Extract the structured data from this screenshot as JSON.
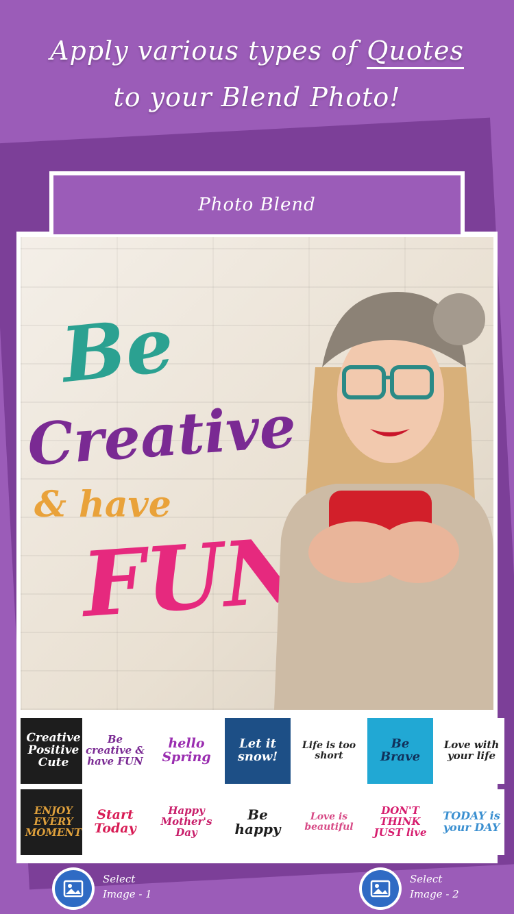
{
  "headline": {
    "line1_prefix": "Apply various types of ",
    "line1_highlight": "Quotes",
    "line2": "to your Blend Photo!"
  },
  "app_bar": {
    "title": "Photo Blend"
  },
  "photo": {
    "quote_be": "Be",
    "quote_creative": "Creative",
    "quote_have": "& have",
    "quote_fun": "FUN"
  },
  "thumbnails": [
    {
      "text": "Creative Positive Cute"
    },
    {
      "text": "Be creative & have FUN"
    },
    {
      "text": "hello Spring"
    },
    {
      "text": "Let it snow!"
    },
    {
      "text": "Life is too short"
    },
    {
      "text": "Be Brave"
    },
    {
      "text": "Love with your life"
    },
    {
      "text": "ENJOY EVERY MOMENT"
    },
    {
      "text": "Start Today"
    },
    {
      "text": "Happy Mother's Day"
    },
    {
      "text": "Be happy"
    },
    {
      "text": "Love is beautiful"
    },
    {
      "text": "DON'T THINK JUST live"
    },
    {
      "text": "TODAY is your DAY"
    }
  ],
  "buttons": {
    "select1_line1": "Select",
    "select1_line2": "Image - 1",
    "select2_line1": "Select",
    "select2_line2": "Image - 2"
  },
  "colors": {
    "background": "#9b5cb8",
    "accent": "#2f6bc4"
  }
}
